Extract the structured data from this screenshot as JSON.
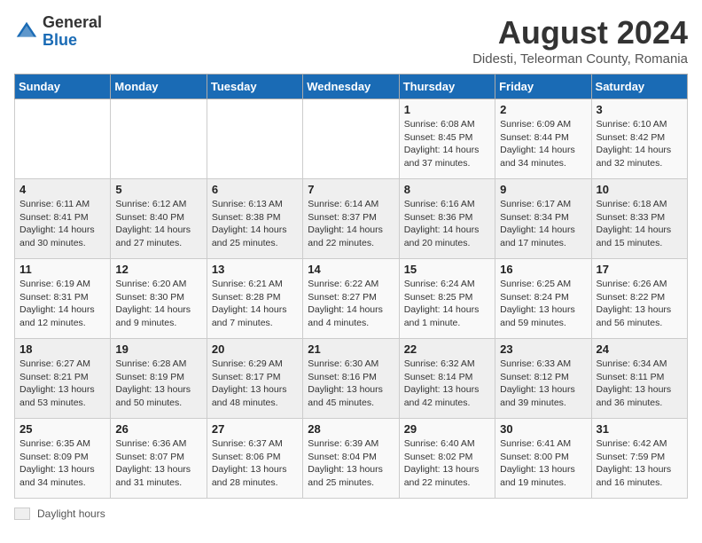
{
  "header": {
    "logo_general": "General",
    "logo_blue": "Blue",
    "month_year": "August 2024",
    "location": "Didesti, Teleorman County, Romania"
  },
  "days_of_week": [
    "Sunday",
    "Monday",
    "Tuesday",
    "Wednesday",
    "Thursday",
    "Friday",
    "Saturday"
  ],
  "footer": {
    "label": "Daylight hours"
  },
  "weeks": [
    [
      {
        "day": "",
        "info": ""
      },
      {
        "day": "",
        "info": ""
      },
      {
        "day": "",
        "info": ""
      },
      {
        "day": "",
        "info": ""
      },
      {
        "day": "1",
        "info": "Sunrise: 6:08 AM\nSunset: 8:45 PM\nDaylight: 14 hours and 37 minutes."
      },
      {
        "day": "2",
        "info": "Sunrise: 6:09 AM\nSunset: 8:44 PM\nDaylight: 14 hours and 34 minutes."
      },
      {
        "day": "3",
        "info": "Sunrise: 6:10 AM\nSunset: 8:42 PM\nDaylight: 14 hours and 32 minutes."
      }
    ],
    [
      {
        "day": "4",
        "info": "Sunrise: 6:11 AM\nSunset: 8:41 PM\nDaylight: 14 hours and 30 minutes."
      },
      {
        "day": "5",
        "info": "Sunrise: 6:12 AM\nSunset: 8:40 PM\nDaylight: 14 hours and 27 minutes."
      },
      {
        "day": "6",
        "info": "Sunrise: 6:13 AM\nSunset: 8:38 PM\nDaylight: 14 hours and 25 minutes."
      },
      {
        "day": "7",
        "info": "Sunrise: 6:14 AM\nSunset: 8:37 PM\nDaylight: 14 hours and 22 minutes."
      },
      {
        "day": "8",
        "info": "Sunrise: 6:16 AM\nSunset: 8:36 PM\nDaylight: 14 hours and 20 minutes."
      },
      {
        "day": "9",
        "info": "Sunrise: 6:17 AM\nSunset: 8:34 PM\nDaylight: 14 hours and 17 minutes."
      },
      {
        "day": "10",
        "info": "Sunrise: 6:18 AM\nSunset: 8:33 PM\nDaylight: 14 hours and 15 minutes."
      }
    ],
    [
      {
        "day": "11",
        "info": "Sunrise: 6:19 AM\nSunset: 8:31 PM\nDaylight: 14 hours and 12 minutes."
      },
      {
        "day": "12",
        "info": "Sunrise: 6:20 AM\nSunset: 8:30 PM\nDaylight: 14 hours and 9 minutes."
      },
      {
        "day": "13",
        "info": "Sunrise: 6:21 AM\nSunset: 8:28 PM\nDaylight: 14 hours and 7 minutes."
      },
      {
        "day": "14",
        "info": "Sunrise: 6:22 AM\nSunset: 8:27 PM\nDaylight: 14 hours and 4 minutes."
      },
      {
        "day": "15",
        "info": "Sunrise: 6:24 AM\nSunset: 8:25 PM\nDaylight: 14 hours and 1 minute."
      },
      {
        "day": "16",
        "info": "Sunrise: 6:25 AM\nSunset: 8:24 PM\nDaylight: 13 hours and 59 minutes."
      },
      {
        "day": "17",
        "info": "Sunrise: 6:26 AM\nSunset: 8:22 PM\nDaylight: 13 hours and 56 minutes."
      }
    ],
    [
      {
        "day": "18",
        "info": "Sunrise: 6:27 AM\nSunset: 8:21 PM\nDaylight: 13 hours and 53 minutes."
      },
      {
        "day": "19",
        "info": "Sunrise: 6:28 AM\nSunset: 8:19 PM\nDaylight: 13 hours and 50 minutes."
      },
      {
        "day": "20",
        "info": "Sunrise: 6:29 AM\nSunset: 8:17 PM\nDaylight: 13 hours and 48 minutes."
      },
      {
        "day": "21",
        "info": "Sunrise: 6:30 AM\nSunset: 8:16 PM\nDaylight: 13 hours and 45 minutes."
      },
      {
        "day": "22",
        "info": "Sunrise: 6:32 AM\nSunset: 8:14 PM\nDaylight: 13 hours and 42 minutes."
      },
      {
        "day": "23",
        "info": "Sunrise: 6:33 AM\nSunset: 8:12 PM\nDaylight: 13 hours and 39 minutes."
      },
      {
        "day": "24",
        "info": "Sunrise: 6:34 AM\nSunset: 8:11 PM\nDaylight: 13 hours and 36 minutes."
      }
    ],
    [
      {
        "day": "25",
        "info": "Sunrise: 6:35 AM\nSunset: 8:09 PM\nDaylight: 13 hours and 34 minutes."
      },
      {
        "day": "26",
        "info": "Sunrise: 6:36 AM\nSunset: 8:07 PM\nDaylight: 13 hours and 31 minutes."
      },
      {
        "day": "27",
        "info": "Sunrise: 6:37 AM\nSunset: 8:06 PM\nDaylight: 13 hours and 28 minutes."
      },
      {
        "day": "28",
        "info": "Sunrise: 6:39 AM\nSunset: 8:04 PM\nDaylight: 13 hours and 25 minutes."
      },
      {
        "day": "29",
        "info": "Sunrise: 6:40 AM\nSunset: 8:02 PM\nDaylight: 13 hours and 22 minutes."
      },
      {
        "day": "30",
        "info": "Sunrise: 6:41 AM\nSunset: 8:00 PM\nDaylight: 13 hours and 19 minutes."
      },
      {
        "day": "31",
        "info": "Sunrise: 6:42 AM\nSunset: 7:59 PM\nDaylight: 13 hours and 16 minutes."
      }
    ]
  ]
}
